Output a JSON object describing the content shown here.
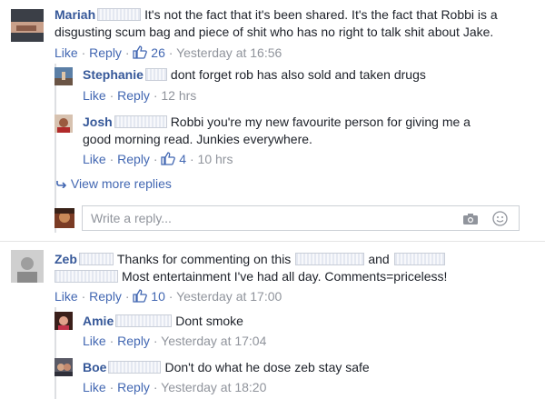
{
  "c1": {
    "name": "Mariah",
    "text_l1": "It's not the fact that it's been shared. It's the fact that Robbi is a",
    "text_l2": "disgusting scum bag and piece of shit who has no right to talk shit about Jake.",
    "like": "Like",
    "reply": "Reply",
    "likes": "26",
    "time": "Yesterday at 16:56"
  },
  "r1": {
    "name": "Stephanie",
    "text": "dont forget rob has also sold and taken drugs",
    "like": "Like",
    "reply": "Reply",
    "time": "12 hrs"
  },
  "r2": {
    "name": "Josh",
    "text_l1": "Robbi you're my new favourite person for giving me a",
    "text_l2": "good morning read. Junkies everywhere.",
    "like": "Like",
    "reply": "Reply",
    "likes": "4",
    "time": "10 hrs"
  },
  "view_more": "View more replies",
  "reply_placeholder": "Write a reply...",
  "c2": {
    "name": "Zeb",
    "text_l1a": "Thanks for commenting on this",
    "text_l1b": "and",
    "text_l2": "Most entertainment I've had all day. Comments=priceless!",
    "like": "Like",
    "reply": "Reply",
    "likes": "10",
    "time": "Yesterday at 17:00"
  },
  "r3": {
    "name": "Amie",
    "text": "Dont smoke",
    "like": "Like",
    "reply": "Reply",
    "time": "Yesterday at 17:04"
  },
  "r4": {
    "name": "Boe",
    "text": "Don't do what he dose zeb stay safe",
    "like": "Like",
    "reply": "Reply",
    "time": "Yesterday at 18:20"
  },
  "sep_dot": "·",
  "colors": {
    "link": "#4267b2",
    "name": "#365899",
    "meta": "#90949c",
    "text": "#1d2129"
  },
  "icons": [
    "thumbs-up-icon",
    "reply-arrow-icon",
    "camera-icon",
    "smiley-icon"
  ]
}
